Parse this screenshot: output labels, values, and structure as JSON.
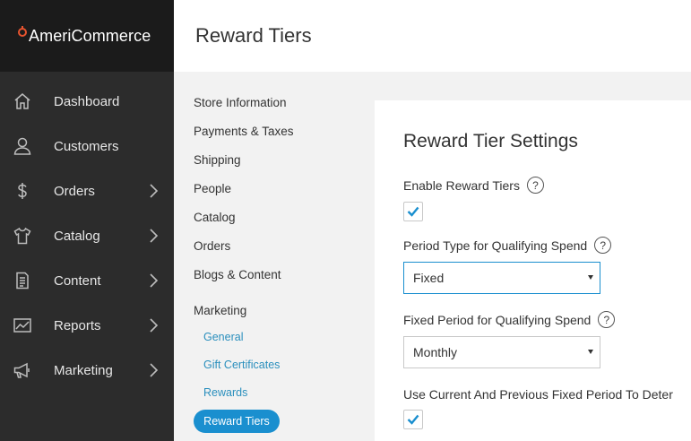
{
  "brand": {
    "name": "AmeriCommerce",
    "accent": "#e8542f"
  },
  "sidebar": {
    "items": [
      {
        "label": "Dashboard",
        "icon": "home-icon",
        "has_children": false
      },
      {
        "label": "Customers",
        "icon": "user-icon",
        "has_children": false
      },
      {
        "label": "Orders",
        "icon": "dollar-icon",
        "has_children": true
      },
      {
        "label": "Catalog",
        "icon": "shirt-icon",
        "has_children": true
      },
      {
        "label": "Content",
        "icon": "document-icon",
        "has_children": true
      },
      {
        "label": "Reports",
        "icon": "chart-icon",
        "has_children": true
      },
      {
        "label": "Marketing",
        "icon": "megaphone-icon",
        "has_children": true
      }
    ]
  },
  "header": {
    "title": "Reward Tiers"
  },
  "subnav": {
    "items": [
      "Store Information",
      "Payments & Taxes",
      "Shipping",
      "People",
      "Catalog",
      "Orders",
      "Blogs & Content",
      "Marketing"
    ],
    "children": [
      "General",
      "Gift Certificates",
      "Rewards"
    ],
    "active": "Reward Tiers"
  },
  "settings": {
    "title": "Reward Tier Settings",
    "enable_label": "Enable Reward Tiers",
    "enable_checked": true,
    "period_type_label": "Period Type for Qualifying Spend",
    "period_type_value": "Fixed",
    "fixed_period_label": "Fixed Period for Qualifying Spend",
    "fixed_period_value": "Monthly",
    "use_current_label": "Use Current And Previous Fixed Period To Deter",
    "use_current_checked": true,
    "help_glyph": "?"
  },
  "colors": {
    "sidebar": "#2c2c2c",
    "brand_bar": "#1b1b1b",
    "active_pill": "#1a8fcf",
    "link": "#2a8fbd"
  }
}
